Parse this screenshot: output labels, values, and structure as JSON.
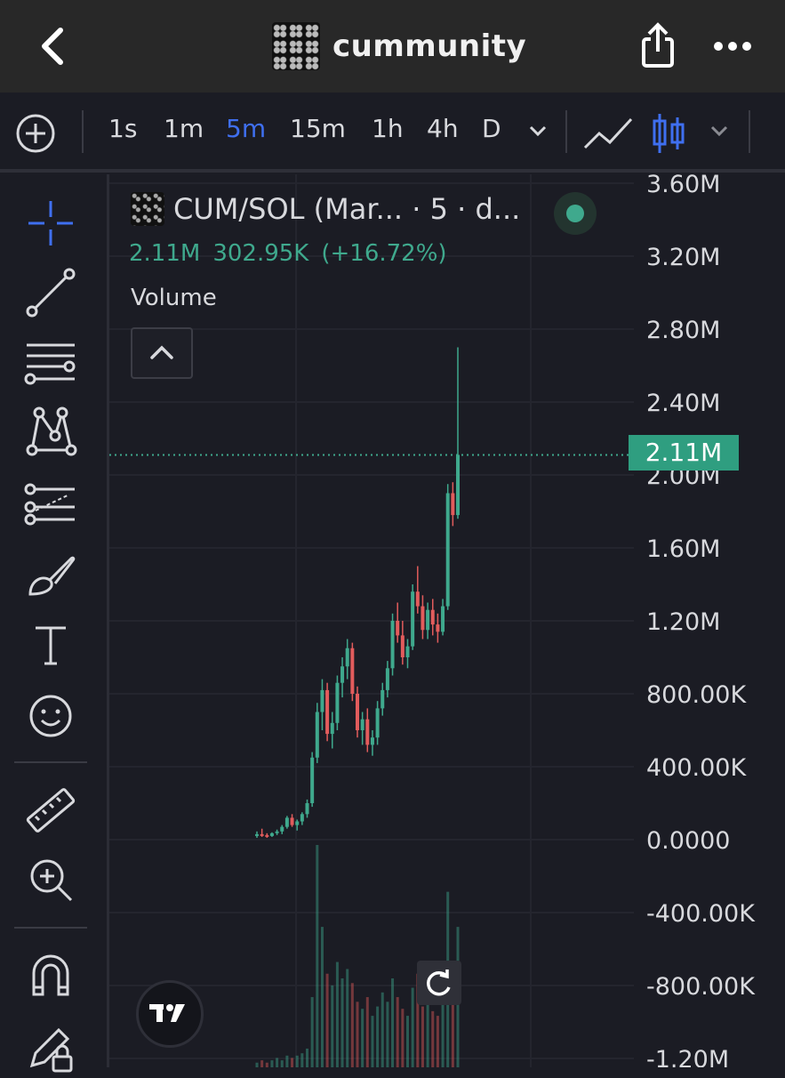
{
  "header": {
    "title": "cummunity",
    "back_icon": "chevron-left-icon",
    "share_icon": "share-icon",
    "more_icon": "more-horizontal-icon"
  },
  "toolbar": {
    "intervals": [
      "1s",
      "1m",
      "5m",
      "15m",
      "1h",
      "4h",
      "D"
    ],
    "active_interval": "5m",
    "chart_style_active": "candles"
  },
  "left_tools": [
    "crosshair-icon",
    "trend-line-icon",
    "fib-retracement-icon",
    "pattern-icon",
    "prediction-icon",
    "brush-icon",
    "text-icon",
    "emoji-icon",
    "ruler-icon",
    "zoom-in-icon",
    "magnet-icon",
    "lock-drawing-icon"
  ],
  "legend": {
    "symbol_text": "CUM/SOL (Mar... · 5 · d...",
    "price": "2.11M",
    "change": "302.95K",
    "change_pct": "(+16.72%)",
    "volume_label": "Volume"
  },
  "price_axis": {
    "labels": [
      "3.60M",
      "3.20M",
      "2.80M",
      "2.40M",
      "2.00M",
      "1.60M",
      "1.20M",
      "800.00K",
      "400.00K",
      "0.0000",
      "-400.00K",
      "-800.00K",
      "-1.20M"
    ],
    "current_price_label": "2.11M"
  },
  "colors": {
    "up": "#3fa98d",
    "down": "#e25c5c",
    "accent": "#3f6ff0",
    "background": "#1b1c24"
  },
  "chart_data": {
    "type": "candlestick",
    "ylim": [
      -1200000,
      3600000
    ],
    "current_price": 2110000,
    "candles": [
      [
        20000,
        45000,
        10000,
        30000
      ],
      [
        30000,
        60000,
        15000,
        25000
      ],
      [
        25000,
        35000,
        10000,
        20000
      ],
      [
        20000,
        40000,
        15000,
        35000
      ],
      [
        35000,
        55000,
        25000,
        45000
      ],
      [
        45000,
        80000,
        30000,
        70000
      ],
      [
        70000,
        130000,
        60000,
        120000
      ],
      [
        120000,
        140000,
        70000,
        80000
      ],
      [
        80000,
        110000,
        50000,
        100000
      ],
      [
        100000,
        150000,
        80000,
        140000
      ],
      [
        140000,
        220000,
        120000,
        200000
      ],
      [
        200000,
        480000,
        180000,
        450000
      ],
      [
        450000,
        750000,
        420000,
        700000
      ],
      [
        700000,
        880000,
        600000,
        820000
      ],
      [
        820000,
        860000,
        540000,
        580000
      ],
      [
        580000,
        700000,
        500000,
        640000
      ],
      [
        640000,
        900000,
        600000,
        860000
      ],
      [
        860000,
        1000000,
        780000,
        950000
      ],
      [
        950000,
        1100000,
        880000,
        1050000
      ],
      [
        1050000,
        1080000,
        760000,
        800000
      ],
      [
        800000,
        840000,
        560000,
        600000
      ],
      [
        600000,
        700000,
        520000,
        660000
      ],
      [
        660000,
        720000,
        480000,
        520000
      ],
      [
        520000,
        600000,
        460000,
        560000
      ],
      [
        560000,
        760000,
        520000,
        720000
      ],
      [
        720000,
        860000,
        680000,
        820000
      ],
      [
        820000,
        980000,
        780000,
        940000
      ],
      [
        940000,
        1240000,
        900000,
        1200000
      ],
      [
        1200000,
        1300000,
        1080000,
        1120000
      ],
      [
        1120000,
        1200000,
        960000,
        1000000
      ],
      [
        1000000,
        1100000,
        940000,
        1060000
      ],
      [
        1060000,
        1400000,
        1040000,
        1360000
      ],
      [
        1360000,
        1500000,
        1240000,
        1280000
      ],
      [
        1280000,
        1340000,
        1100000,
        1150000
      ],
      [
        1150000,
        1300000,
        1100000,
        1260000
      ],
      [
        1260000,
        1320000,
        1120000,
        1180000
      ],
      [
        1180000,
        1240000,
        1080000,
        1140000
      ],
      [
        1140000,
        1320000,
        1120000,
        1280000
      ],
      [
        1280000,
        1950000,
        1260000,
        1900000
      ],
      [
        1900000,
        1960000,
        1720000,
        1780000
      ],
      [
        1780000,
        2700000,
        1760000,
        2110000
      ]
    ],
    "volume": [
      2,
      3,
      2,
      3,
      4,
      3,
      5,
      4,
      5,
      6,
      8,
      30,
      95,
      60,
      40,
      35,
      45,
      38,
      42,
      36,
      28,
      25,
      30,
      22,
      26,
      32,
      28,
      38,
      30,
      25,
      22,
      34,
      40,
      26,
      28,
      24,
      22,
      30,
      75,
      45,
      60
    ]
  }
}
